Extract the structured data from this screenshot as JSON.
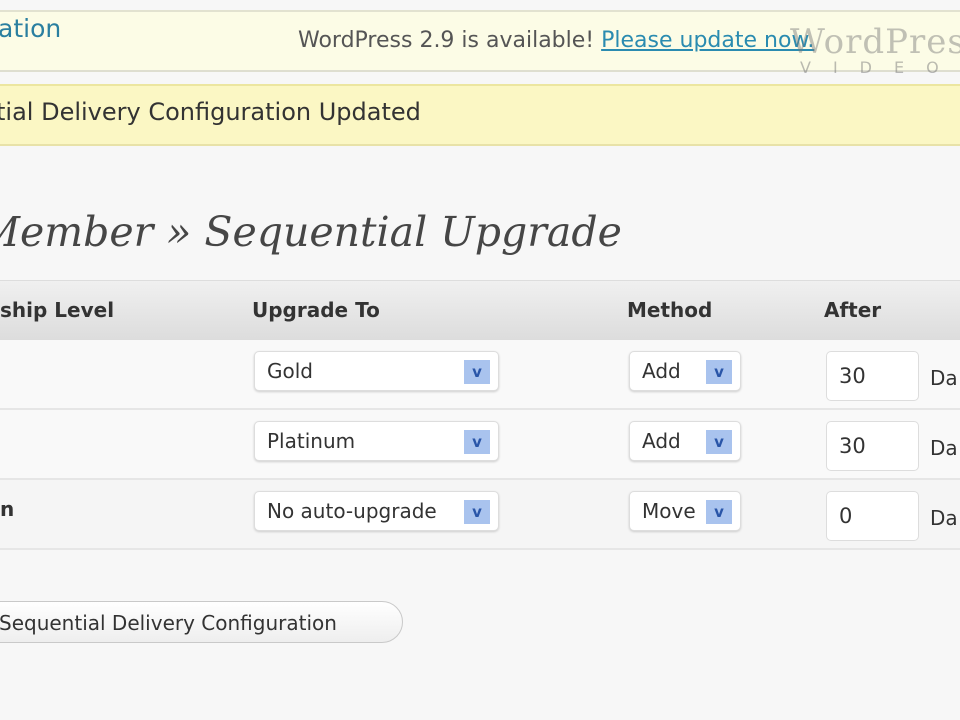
{
  "nag": {
    "breadcrumb": "ation",
    "text": "WordPress 2.9 is available! ",
    "link": "Please update now."
  },
  "message": "tial Delivery Configuration Updated",
  "title": "Member » Sequential Upgrade",
  "table": {
    "headers": [
      "ship Level",
      "Upgrade To",
      "Method",
      "After"
    ],
    "rows": [
      {
        "level": "",
        "upgrade": "Gold",
        "method": "Add",
        "after": "30",
        "unit": "Da"
      },
      {
        "level": "",
        "upgrade": "Platinum",
        "method": "Add",
        "after": "30",
        "unit": "Da"
      },
      {
        "level": "n",
        "upgrade": "No auto-upgrade",
        "method": "Move",
        "after": "0",
        "unit": "Da"
      }
    ]
  },
  "save_button": "Sequential Delivery Configuration",
  "watermark": {
    "brand": "WordPress",
    "sub": "VIDEO"
  },
  "icons": {
    "dropdown": "chevron-down-icon"
  }
}
